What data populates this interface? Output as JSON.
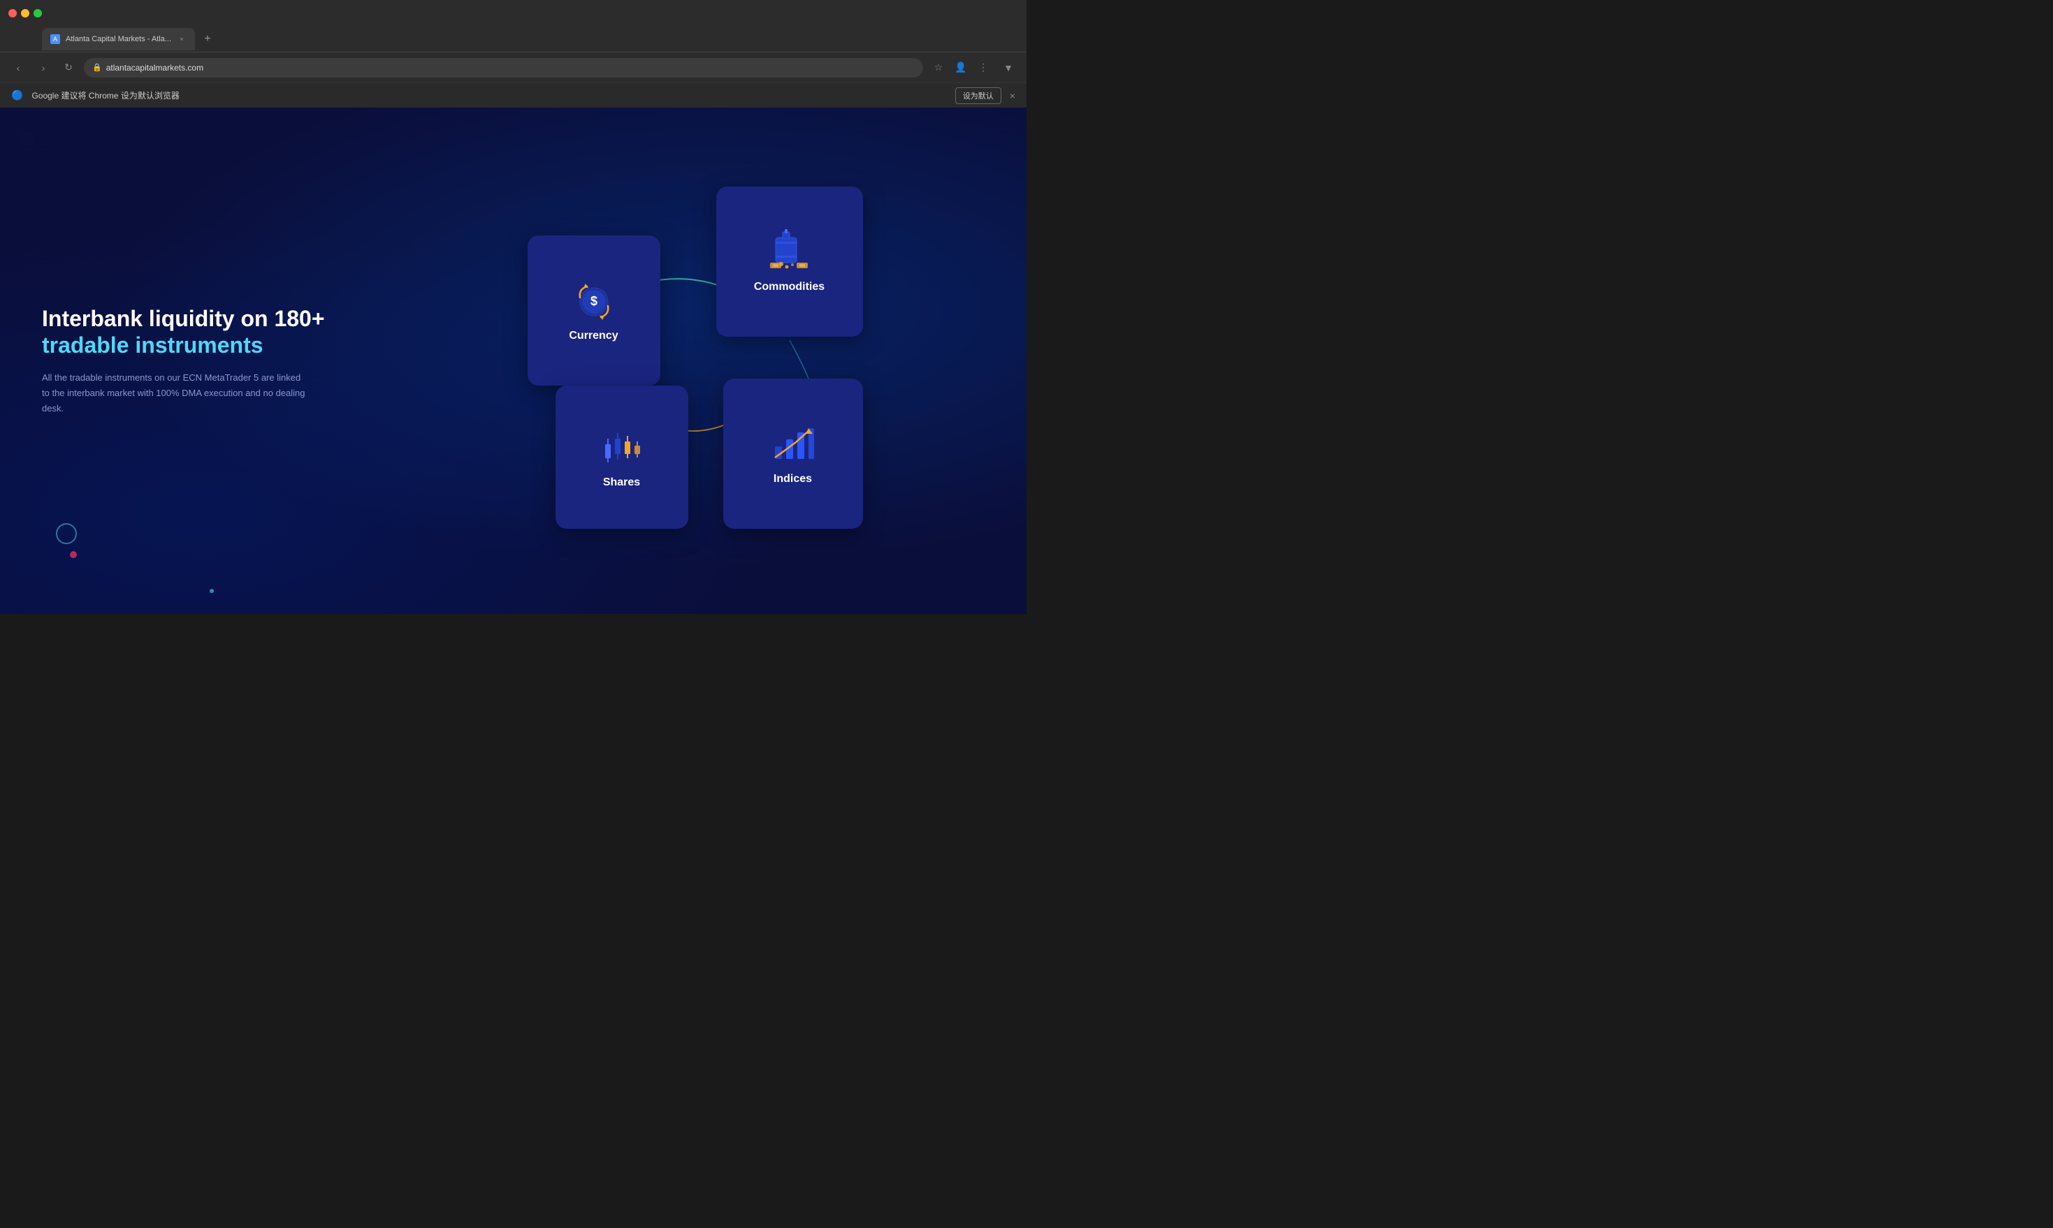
{
  "browser": {
    "traffic_lights": [
      "red",
      "yellow",
      "green"
    ],
    "tab": {
      "favicon_label": "A",
      "title": "Atlanta Capital Markets - Atla...",
      "close_icon": "×"
    },
    "new_tab_icon": "+",
    "nav": {
      "back_icon": "‹",
      "forward_icon": "›",
      "refresh_icon": "↻",
      "address": "atlantacapitalmarkets.com",
      "bookmark_icon": "☆",
      "profile_icon": "👤",
      "menu_icon": "⋮",
      "dropdown_icon": "▼"
    },
    "info_bar": {
      "message": "Google 建议将 Chrome 设为默认浏览器",
      "action_label": "设为默认",
      "close_icon": "×"
    }
  },
  "website": {
    "headline_part1": "Interbank liquidity on 180+",
    "headline_part2": "tradable instruments",
    "description": "All the tradable instruments on our ECN MetaTrader 5 are linked to the interbank market with 100% DMA execution and no dealing desk.",
    "cards": [
      {
        "id": "currency",
        "label": "Currency",
        "icon_type": "currency"
      },
      {
        "id": "commodities",
        "label": "Commodities",
        "icon_type": "commodities"
      },
      {
        "id": "shares",
        "label": "Shares",
        "icon_type": "shares"
      },
      {
        "id": "indices",
        "label": "Indices",
        "icon_type": "indices"
      }
    ]
  }
}
